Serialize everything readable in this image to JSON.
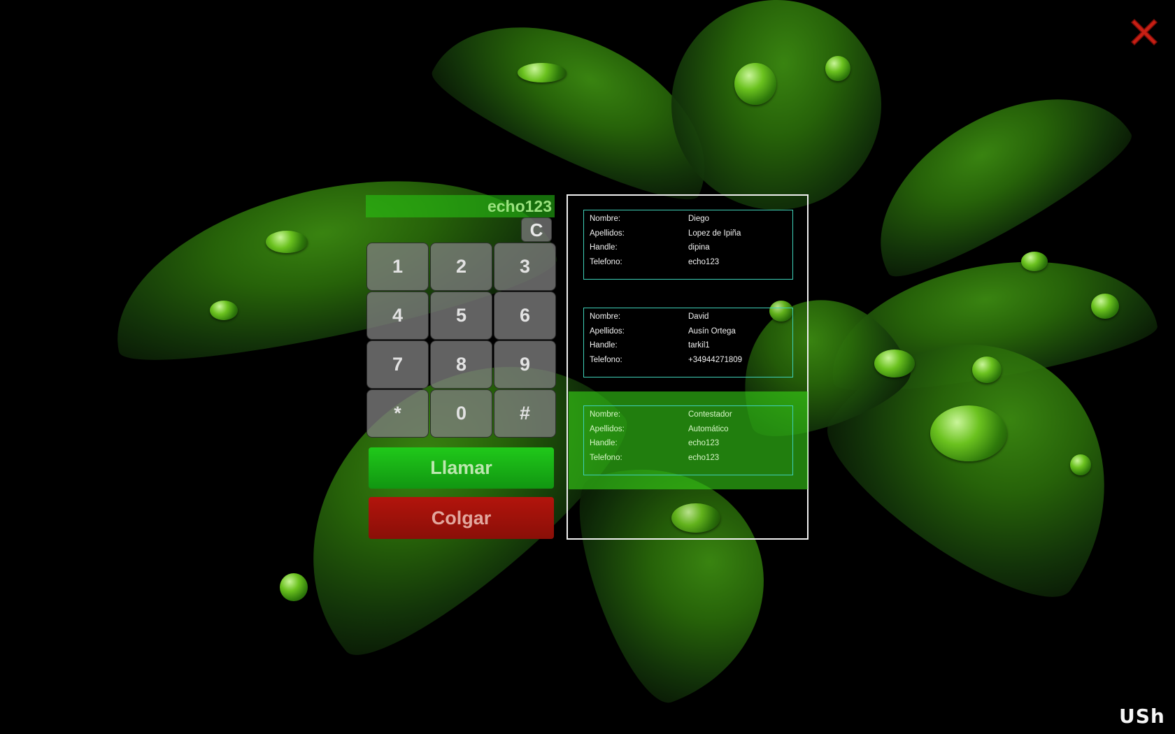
{
  "window": {
    "close_icon": "close-x-icon",
    "accent_green": "#2fd11c",
    "hangup_red": "#a81208"
  },
  "dialer": {
    "display_value": "echo123",
    "clear_label": "C",
    "keys": [
      "1",
      "2",
      "3",
      "4",
      "5",
      "6",
      "7",
      "8",
      "9",
      "*",
      "0",
      "#"
    ],
    "call_label": "Llamar",
    "hangup_label": "Colgar"
  },
  "contacts": {
    "labels": {
      "first_name": "Nombre:",
      "last_name": "Apellidos:",
      "handle": "Handle:",
      "phone": "Telefono:"
    },
    "items": [
      {
        "first_name": "Diego",
        "last_name": "Lopez de Ipiña",
        "handle": "dipina",
        "phone": "echo123",
        "selected": false
      },
      {
        "first_name": "David",
        "last_name": "Ausín Ortega",
        "handle": "tarkil1",
        "phone": "+34944271809",
        "selected": false
      },
      {
        "first_name": "Contestador",
        "last_name": "Automático",
        "handle": "echo123",
        "phone": "echo123",
        "selected": true
      }
    ]
  },
  "logo": {
    "text": "USh"
  }
}
